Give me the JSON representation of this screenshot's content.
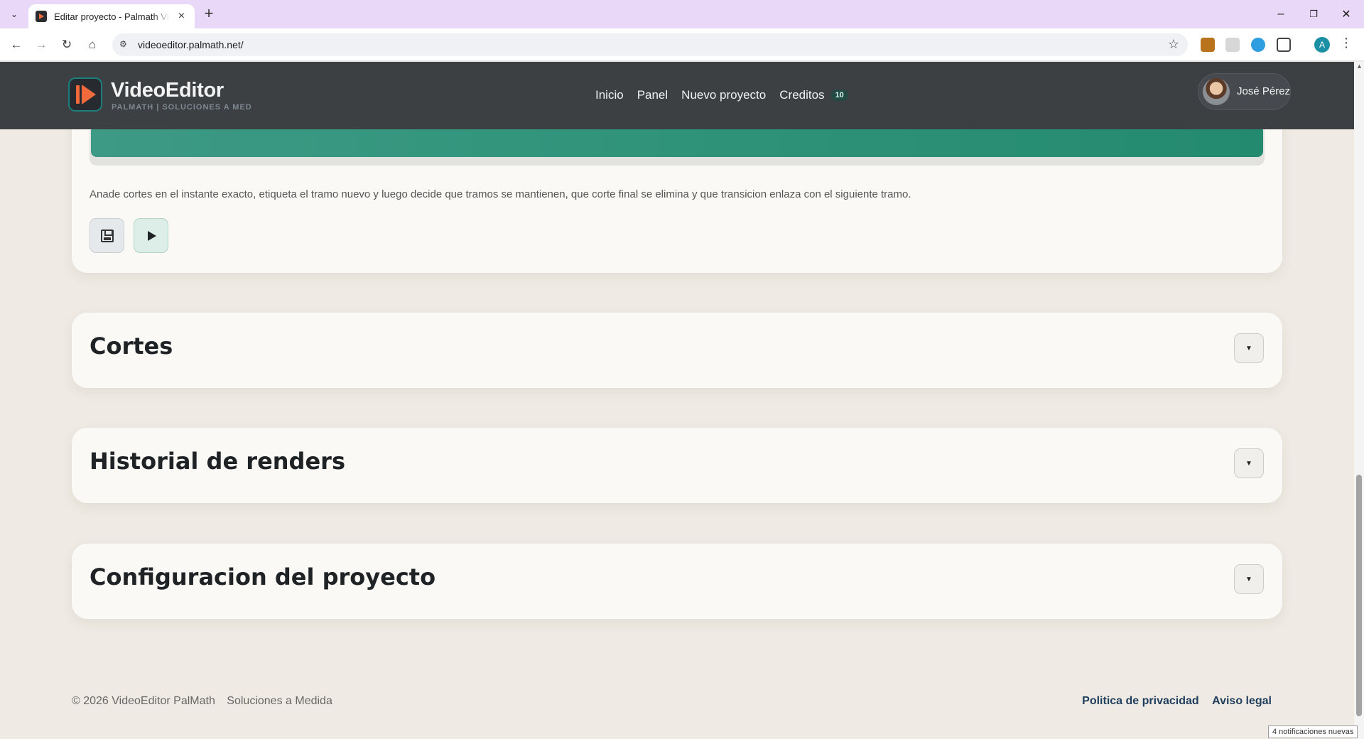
{
  "browser": {
    "tab_title": "Editar proyecto - Palmath VideoEditor",
    "url": "videoeditor.palmath.net/",
    "profile_initial": "A"
  },
  "header": {
    "logo_name": "VideoEditor",
    "logo_sub": "PALMATH | SOLUCIONES A MED",
    "nav": [
      "Inicio",
      "Panel",
      "Nuevo proyecto",
      "Creditos"
    ],
    "credits_count": "10",
    "user_name": "José Pérez"
  },
  "timeline": {
    "note": "Anade cortes en el instante exacto, etiqueta el tramo nuevo y luego decide que tramos se mantienen, que corte final se elimina y que transicion enlaza con el siguiente tramo.",
    "fill_color": "#2f9379"
  },
  "sections": [
    {
      "title": "Cortes"
    },
    {
      "title": "Historial de renders"
    },
    {
      "title": "Configuracion del proyecto"
    }
  ],
  "footer": {
    "copyright": "© 2026 VideoEditor PalMath",
    "tagline": "Soluciones a Medida",
    "links": [
      "Politica de privacidad",
      "Aviso legal"
    ]
  },
  "notification": "4 notificaciones nuevas",
  "colors": {
    "header_bg": "#3c4043",
    "accent_orange": "#f06a3c",
    "accent_green": "#2f9379",
    "page_bg": "#efebe4"
  }
}
